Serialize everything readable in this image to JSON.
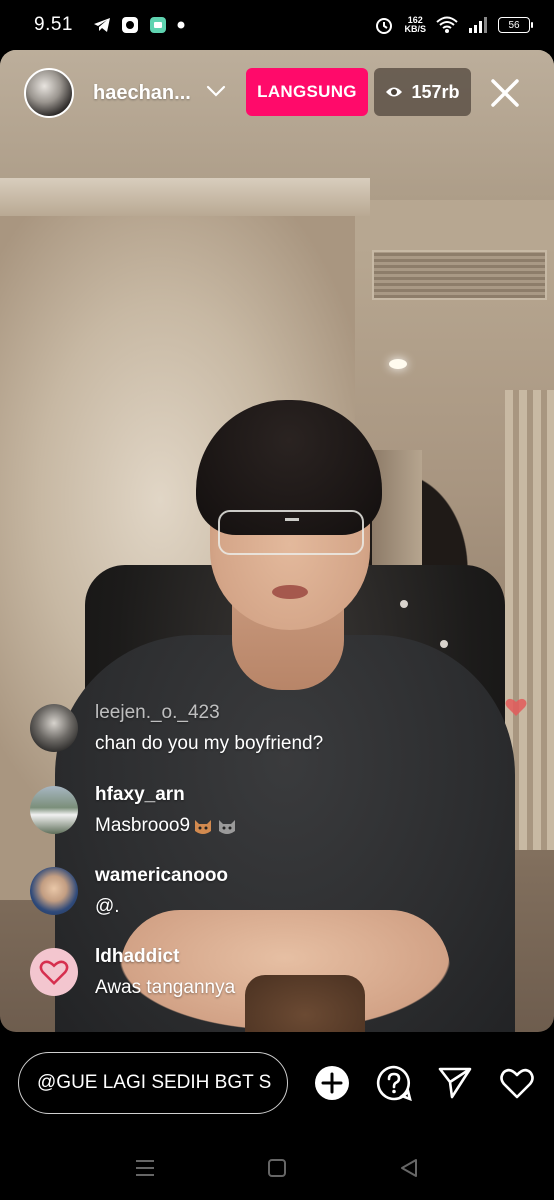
{
  "status_bar": {
    "time": "9.51",
    "speed_value": "162",
    "speed_unit": "KB/S",
    "battery": "56"
  },
  "header": {
    "username": "haechan...",
    "live_label": "LANGSUNG",
    "viewer_count": "157rb"
  },
  "comments": [
    {
      "user": "leejen._o._423",
      "text": "chan do you my boyfriend?"
    },
    {
      "user": "hfaxy_arn",
      "text": "Masbrooo9"
    },
    {
      "user": "wamericanooo",
      "text": "@."
    },
    {
      "user": "ldhaddict",
      "text": "Awas tangannya"
    }
  ],
  "composer": {
    "input_value": "@GUE LAGI SEDIH BGT S"
  },
  "colors": {
    "live_badge": "#ff0a6a",
    "viewer_badge": "#50463c"
  }
}
